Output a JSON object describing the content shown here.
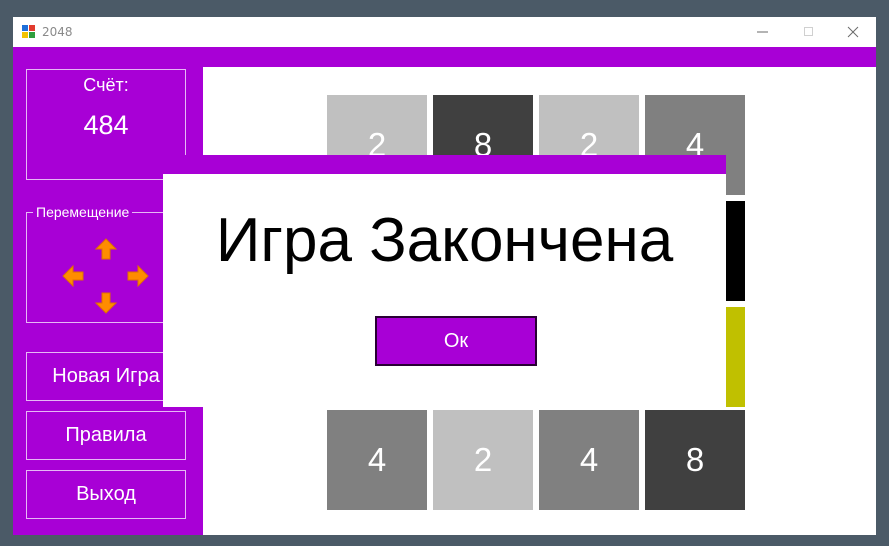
{
  "window": {
    "title": "2048",
    "icon": "app-icon",
    "controls": [
      "minimize-icon",
      "maximize-icon",
      "close-icon"
    ]
  },
  "colors": {
    "accent": "#a800d6",
    "tile_2": "#c0c0c0",
    "tile_4": "#808080",
    "tile_8": "#404040",
    "tile_dark": "#000000",
    "tile_olive": "#c0c000",
    "arrow": "#ff8c00"
  },
  "sidebar": {
    "score_label": "Счёт:",
    "score_value": "484",
    "move_legend": "Перемещение",
    "arrows": [
      "arrow-up-icon",
      "arrow-left-icon",
      "arrow-right-icon",
      "arrow-down-icon"
    ],
    "new_game": "Новая Игра",
    "rules": "Правила",
    "exit": "Выход"
  },
  "board": {
    "visible_tiles": [
      "2",
      "8",
      "2",
      "4",
      "",
      "",
      "",
      "4",
      "2",
      "4",
      "8"
    ]
  },
  "dialog": {
    "message": "Игра Закончена",
    "ok": "Ок"
  }
}
